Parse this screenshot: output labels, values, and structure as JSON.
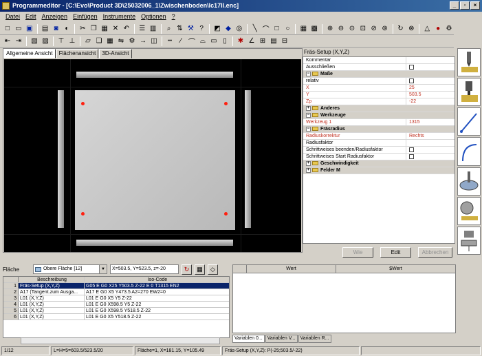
{
  "window": {
    "title": "Programmeditor - [C:\\Evo\\Product 3D\\25032006_1\\Zwischenboden\\Ic17II.enc]"
  },
  "menu": [
    "Datei",
    "Edit",
    "Anzeigen",
    "Einfügen",
    "Instrumente",
    "Optionen",
    "?"
  ],
  "view": {
    "tabs": [
      "Allgemeine Ansicht",
      "Flächenansicht",
      "3D-Ansicht"
    ]
  },
  "properties": {
    "title": "Fräs-Setup (X,Y,Z)",
    "rows": [
      {
        "key": "Kommentar",
        "value": ""
      },
      {
        "key": "Ausschließen",
        "value": ""
      },
      {
        "group": "Maße"
      },
      {
        "key": "relativ",
        "value": ""
      },
      {
        "key": "X",
        "value": "25"
      },
      {
        "key": "Y",
        "value": "503.5"
      },
      {
        "key": "Zp",
        "value": "-22"
      },
      {
        "group": "Anderes"
      },
      {
        "group": "Werkzeuge"
      },
      {
        "key": "Werkzeug 1",
        "value": "1315"
      },
      {
        "group": "Fräsradius"
      },
      {
        "key": "Radiuskorrektur",
        "value": "Rechts"
      },
      {
        "key": "Radiusfaktor",
        "value": ""
      },
      {
        "key": "Schrittweises beenden/Radiusfaktor",
        "value": ""
      },
      {
        "key": "Schrittweises Start Radiusfaktor",
        "value": ""
      },
      {
        "group": "Geschwindigkeit"
      },
      {
        "group": "Felder M"
      }
    ],
    "buttons": {
      "apply": "Wie",
      "edit": "Edit",
      "cancel": "Abbrechen"
    }
  },
  "surface": {
    "label": "Fläche",
    "selected": "Obere Fläche [12]",
    "coords": "X=503.5, Y=523.5, z=-20"
  },
  "program_table": {
    "headers": [
      "Beschreibung",
      "Iso-Code"
    ],
    "rows": [
      {
        "n": "1",
        "desc": "Fräs-Setup (X,Y,Z)",
        "iso": "G05 E G0 X25 Y503.5 Z-22 E 0 T1315 EN2"
      },
      {
        "n": "2",
        "desc": "A17 (Tangent.zum Ausga...",
        "iso": "A17 E G0 X5 Y473.5 A2=270 EW2=0"
      },
      {
        "n": "3",
        "desc": "L01 (X,Y,Z)",
        "iso": "L01 E G0 X5 Y5 Z-22"
      },
      {
        "n": "4",
        "desc": "L01 (X,Y,Z)",
        "iso": "L01 E G0 X598.5 Y5 Z-22"
      },
      {
        "n": "5",
        "desc": "L01 (X,Y,Z)",
        "iso": "L01 E G0 X598.5 Y518.5 Z-22"
      },
      {
        "n": "6",
        "desc": "L01 (X,Y,Z)",
        "iso": "L01 E G0 X5 Y518.5 Z-22"
      }
    ]
  },
  "variables": {
    "headers": [
      "Wert",
      "$Wert"
    ],
    "tabs": [
      "Variablen 0...",
      "Variablen V...",
      "Variablen R..."
    ]
  },
  "status": {
    "line": "1/12",
    "dims": "L=H=5=603.5/523.5/20",
    "face": "Fläche=1, X=181.15, Y=105.49",
    "setup": "Fräs-Setup (X,Y,Z): P(-25;503.5/-22)"
  }
}
